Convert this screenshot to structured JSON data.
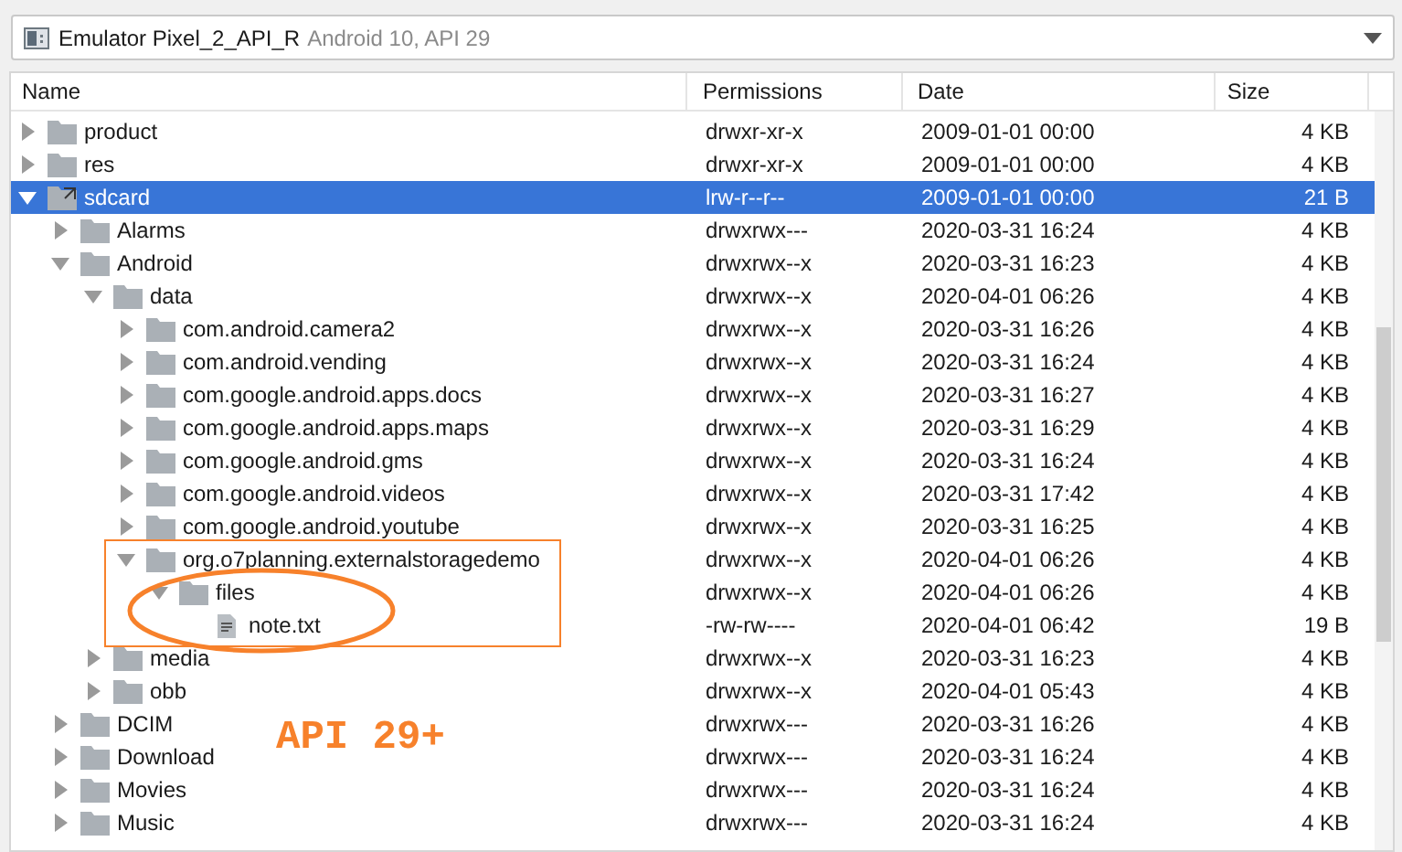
{
  "device_selector": {
    "device": "Emulator Pixel_2_API_R",
    "detail": "Android 10, API 29"
  },
  "columns": [
    "Name",
    "Permissions",
    "Date",
    "Size"
  ],
  "tree": [
    {
      "name": "product",
      "kind": "folder",
      "expanded": false,
      "selected": false,
      "permissions": "drwxr-xr-x",
      "date": "2009-01-01 00:00",
      "size": "4 KB"
    },
    {
      "name": "res",
      "kind": "folder",
      "expanded": false,
      "selected": false,
      "permissions": "drwxr-xr-x",
      "date": "2009-01-01 00:00",
      "size": "4 KB"
    },
    {
      "name": "sdcard",
      "kind": "link",
      "expanded": true,
      "selected": true,
      "permissions": "lrw-r--r--",
      "date": "2009-01-01 00:00",
      "size": "21 B",
      "children": [
        {
          "name": "Alarms",
          "kind": "folder",
          "expanded": false,
          "selected": false,
          "permissions": "drwxrwx---",
          "date": "2020-03-31 16:24",
          "size": "4 KB"
        },
        {
          "name": "Android",
          "kind": "folder",
          "expanded": true,
          "selected": false,
          "permissions": "drwxrwx--x",
          "date": "2020-03-31 16:23",
          "size": "4 KB",
          "children": [
            {
              "name": "data",
              "kind": "folder",
              "expanded": true,
              "selected": false,
              "permissions": "drwxrwx--x",
              "date": "2020-04-01 06:26",
              "size": "4 KB",
              "children": [
                {
                  "name": "com.android.camera2",
                  "kind": "folder",
                  "expanded": false,
                  "selected": false,
                  "permissions": "drwxrwx--x",
                  "date": "2020-03-31 16:26",
                  "size": "4 KB"
                },
                {
                  "name": "com.android.vending",
                  "kind": "folder",
                  "expanded": false,
                  "selected": false,
                  "permissions": "drwxrwx--x",
                  "date": "2020-03-31 16:24",
                  "size": "4 KB"
                },
                {
                  "name": "com.google.android.apps.docs",
                  "kind": "folder",
                  "expanded": false,
                  "selected": false,
                  "permissions": "drwxrwx--x",
                  "date": "2020-03-31 16:27",
                  "size": "4 KB"
                },
                {
                  "name": "com.google.android.apps.maps",
                  "kind": "folder",
                  "expanded": false,
                  "selected": false,
                  "permissions": "drwxrwx--x",
                  "date": "2020-03-31 16:29",
                  "size": "4 KB"
                },
                {
                  "name": "com.google.android.gms",
                  "kind": "folder",
                  "expanded": false,
                  "selected": false,
                  "permissions": "drwxrwx--x",
                  "date": "2020-03-31 16:24",
                  "size": "4 KB"
                },
                {
                  "name": "com.google.android.videos",
                  "kind": "folder",
                  "expanded": false,
                  "selected": false,
                  "permissions": "drwxrwx--x",
                  "date": "2020-03-31 17:42",
                  "size": "4 KB"
                },
                {
                  "name": "com.google.android.youtube",
                  "kind": "folder",
                  "expanded": false,
                  "selected": false,
                  "permissions": "drwxrwx--x",
                  "date": "2020-03-31 16:25",
                  "size": "4 KB"
                },
                {
                  "name": "org.o7planning.externalstoragedemo",
                  "kind": "folder",
                  "expanded": true,
                  "selected": false,
                  "permissions": "drwxrwx--x",
                  "date": "2020-04-01 06:26",
                  "size": "4 KB",
                  "children": [
                    {
                      "name": "files",
                      "kind": "folder",
                      "expanded": true,
                      "selected": false,
                      "permissions": "drwxrwx--x",
                      "date": "2020-04-01 06:26",
                      "size": "4 KB",
                      "children": [
                        {
                          "name": "note.txt",
                          "kind": "file",
                          "selected": false,
                          "permissions": "-rw-rw----",
                          "date": "2020-04-01 06:42",
                          "size": "19 B"
                        }
                      ]
                    }
                  ]
                }
              ]
            },
            {
              "name": "media",
              "kind": "folder",
              "expanded": false,
              "selected": false,
              "permissions": "drwxrwx--x",
              "date": "2020-03-31 16:23",
              "size": "4 KB"
            },
            {
              "name": "obb",
              "kind": "folder",
              "expanded": false,
              "selected": false,
              "permissions": "drwxrwx--x",
              "date": "2020-04-01 05:43",
              "size": "4 KB"
            }
          ]
        },
        {
          "name": "DCIM",
          "kind": "folder",
          "expanded": false,
          "selected": false,
          "permissions": "drwxrwx---",
          "date": "2020-03-31 16:26",
          "size": "4 KB"
        },
        {
          "name": "Download",
          "kind": "folder",
          "expanded": false,
          "selected": false,
          "permissions": "drwxrwx---",
          "date": "2020-03-31 16:24",
          "size": "4 KB"
        },
        {
          "name": "Movies",
          "kind": "folder",
          "expanded": false,
          "selected": false,
          "permissions": "drwxrwx---",
          "date": "2020-03-31 16:24",
          "size": "4 KB"
        },
        {
          "name": "Music",
          "kind": "folder",
          "expanded": false,
          "selected": false,
          "permissions": "drwxrwx---",
          "date": "2020-03-31 16:24",
          "size": "4 KB"
        }
      ]
    }
  ],
  "annotation": {
    "label": "API 29+",
    "color": "#f7812b"
  }
}
